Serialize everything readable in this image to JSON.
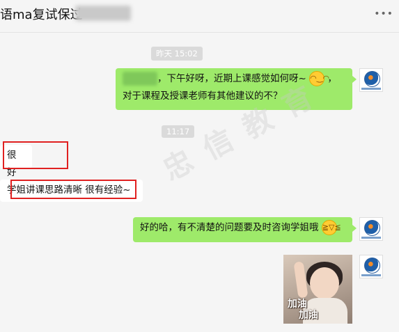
{
  "chat": {
    "title": "语ma复试保过",
    "more_icon": "more-icon"
  },
  "timestamps": [
    "昨天 15:02",
    "11:17"
  ],
  "messages": [
    {
      "sender": "me",
      "line1": "，下午好呀，近期上课感觉如何呀~",
      "line1_tail": "，",
      "line2": "对于课程及授课老师有其他建议的不？",
      "emoji": "grinning-face-icon"
    },
    {
      "sender": "other",
      "text": "很好"
    },
    {
      "sender": "other",
      "text": "学姐讲课思路清晰 很有经验~"
    },
    {
      "sender": "me",
      "text": "好的哈，有不清楚的问题要及时咨询学姐哦",
      "emoji": "laughing-face-icon"
    },
    {
      "sender": "me",
      "type": "image",
      "caption_top": "加油",
      "caption_bottom": "加油"
    }
  ],
  "watermark": "忠 信 教 育",
  "colors": {
    "my_bubble": "#9eea6a",
    "their_bubble": "#ffffff",
    "highlight": "#e02020"
  }
}
